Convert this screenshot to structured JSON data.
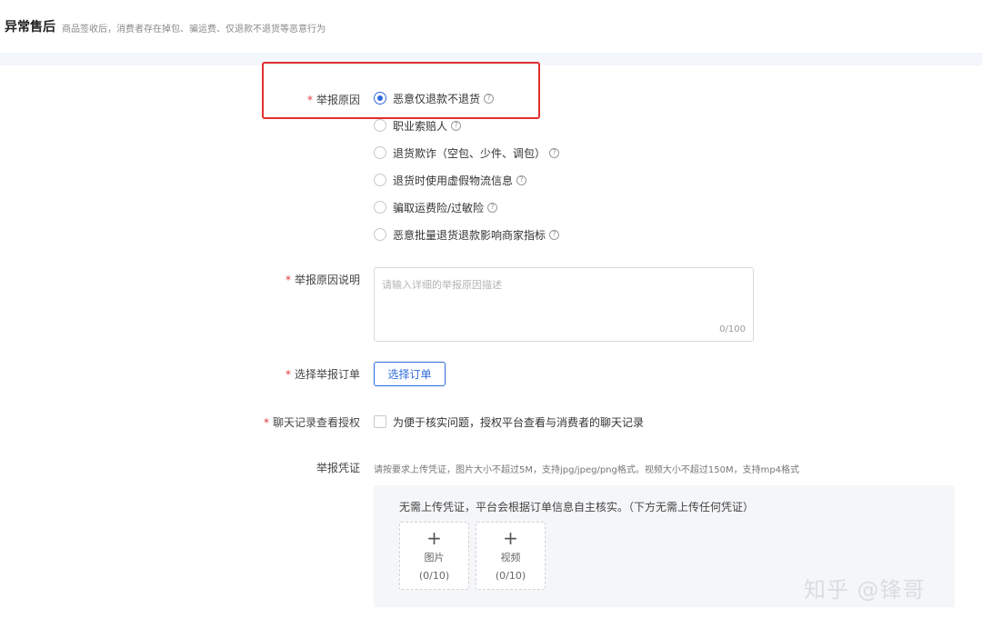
{
  "header": {
    "title": "异常售后",
    "description": "商品签收后，消费者存在掉包、骗运费、仅退款不退货等恶意行为"
  },
  "form": {
    "reason": {
      "label": "举报原因",
      "options": [
        {
          "label": "恶意仅退款不退货",
          "checked": true
        },
        {
          "label": "职业索赔人",
          "checked": false
        },
        {
          "label": "退货欺诈（空包、少件、调包）",
          "checked": false
        },
        {
          "label": "退货时使用虚假物流信息",
          "checked": false
        },
        {
          "label": "骗取运费险/过敏险",
          "checked": false
        },
        {
          "label": "恶意批量退货退款影响商家指标",
          "checked": false
        }
      ]
    },
    "reason_desc": {
      "label": "举报原因说明",
      "placeholder": "请输入详细的举报原因描述",
      "counter": "0/100"
    },
    "order": {
      "label": "选择举报订单",
      "button": "选择订单"
    },
    "chat_auth": {
      "label": "聊天记录查看授权",
      "checkbox_label": "为便于核实问题，授权平台查看与消费者的聊天记录"
    },
    "evidence": {
      "label": "举报凭证",
      "hint": "请按要求上传凭证，图片大小不超过5M，支持jpg/jpeg/png格式。视频大小不超过150M，支持mp4格式",
      "notice": "无需上传凭证，平台会根据订单信息自主核实。（下方无需上传任何凭证）",
      "tiles": [
        {
          "label": "图片",
          "count": "(0/10)"
        },
        {
          "label": "视频",
          "count": "(0/10)"
        }
      ]
    }
  },
  "required_mark": "*",
  "help_glyph": "?",
  "plus_glyph": "+",
  "watermark": "知乎 @锋哥",
  "colors": {
    "accent": "#2f6bdc",
    "required": "#e4393c",
    "highlight": "#e02f2f"
  }
}
